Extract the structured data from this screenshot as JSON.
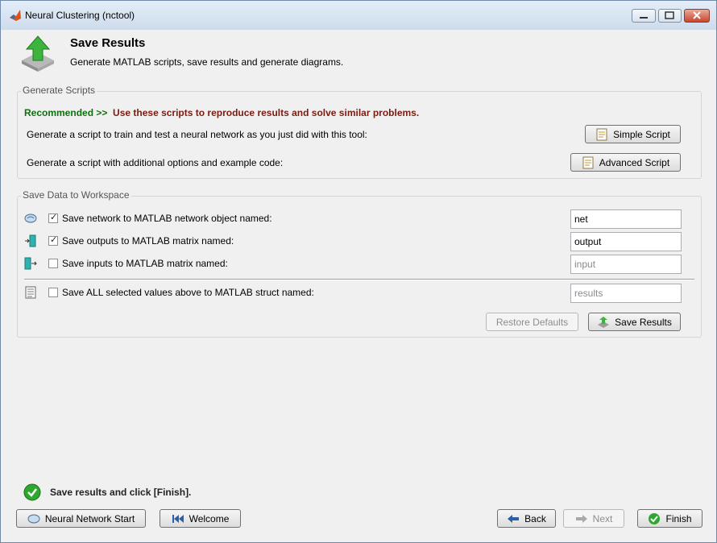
{
  "window": {
    "title": "Neural Clustering (nctool)",
    "controls": [
      "minimize",
      "maximize",
      "close"
    ]
  },
  "header": {
    "title": "Save Results",
    "subtitle": "Generate MATLAB scripts, save results and generate diagrams."
  },
  "generate_scripts": {
    "label": "Generate Scripts",
    "recommended_prefix": "Recommended >>",
    "recommended_text": "Use these scripts to reproduce results and solve similar problems.",
    "simple_desc": "Generate a script to train and test a neural network as you just did with this tool:",
    "simple_button": "Simple Script",
    "advanced_desc": "Generate a script with additional options and example code:",
    "advanced_button": "Advanced Script"
  },
  "save_data": {
    "label": "Save Data to Workspace",
    "rows": [
      {
        "icon": "network-icon",
        "checked": true,
        "label": "Save network to MATLAB network object named:",
        "value": "net",
        "placeholder": ""
      },
      {
        "icon": "output-icon",
        "checked": true,
        "label": "Save outputs to MATLAB matrix named:",
        "value": "output",
        "placeholder": ""
      },
      {
        "icon": "input-icon",
        "checked": false,
        "label": "Save inputs to MATLAB matrix named:",
        "value": "",
        "placeholder": "input"
      },
      {
        "icon": "struct-icon",
        "checked": false,
        "label": "Save ALL selected values above to MATLAB struct named:",
        "value": "",
        "placeholder": "results"
      }
    ],
    "restore_button": "Restore Defaults",
    "save_button": "Save Results"
  },
  "status": {
    "text": "Save results and click [Finish]."
  },
  "footer": {
    "start_button": "Neural Network Start",
    "welcome_button": "Welcome",
    "back_button": "Back",
    "next_button": "Next",
    "finish_button": "Finish"
  },
  "colors": {
    "recommended_green": "#0f6f0f",
    "recommended_red": "#7a1b10",
    "window_bg": "#f0f0f0",
    "titlebar": "#d6e3f2"
  }
}
